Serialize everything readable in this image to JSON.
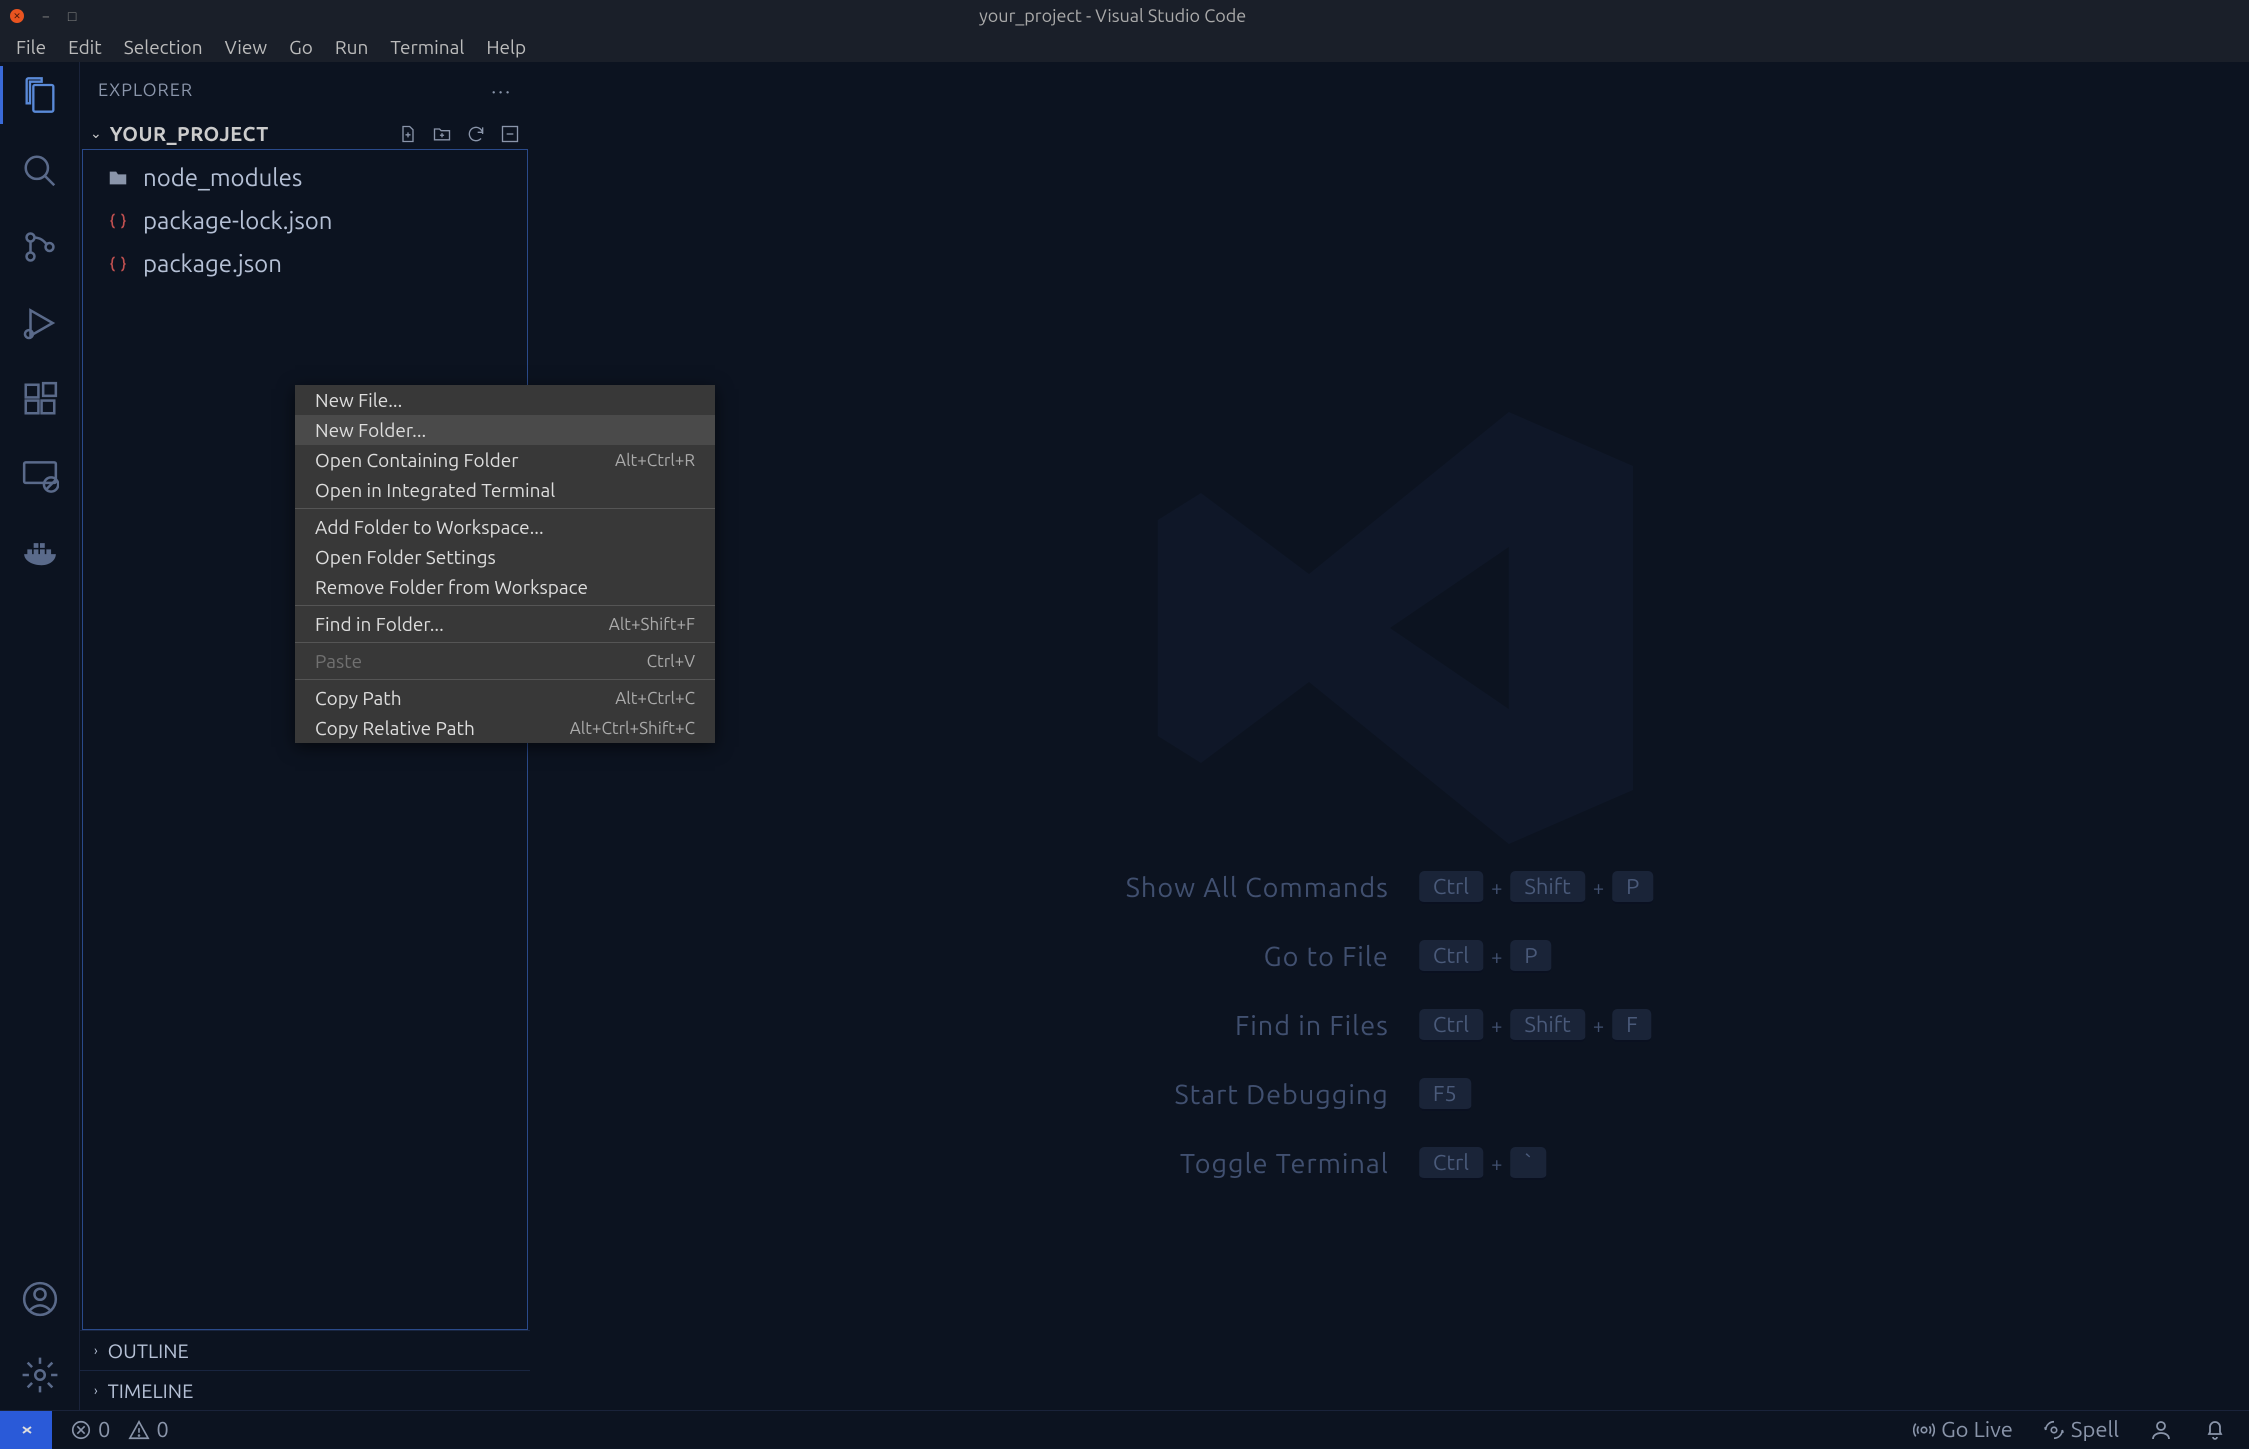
{
  "titlebar": {
    "title": "your_project - Visual Studio Code"
  },
  "menubar": [
    "File",
    "Edit",
    "Selection",
    "View",
    "Go",
    "Run",
    "Terminal",
    "Help"
  ],
  "sidebar": {
    "title": "EXPLORER",
    "folder": "YOUR_PROJECT",
    "files": [
      {
        "name": "node_modules",
        "type": "folder"
      },
      {
        "name": "package-lock.json",
        "type": "json"
      },
      {
        "name": "package.json",
        "type": "json"
      }
    ]
  },
  "panels": {
    "outline": "OUTLINE",
    "timeline": "TIMELINE"
  },
  "context_menu": {
    "groups": [
      [
        {
          "label": "New File...",
          "shortcut": ""
        },
        {
          "label": "New Folder...",
          "shortcut": "",
          "hover": true
        },
        {
          "label": "Open Containing Folder",
          "shortcut": "Alt+Ctrl+R"
        },
        {
          "label": "Open in Integrated Terminal",
          "shortcut": ""
        }
      ],
      [
        {
          "label": "Add Folder to Workspace...",
          "shortcut": ""
        },
        {
          "label": "Open Folder Settings",
          "shortcut": ""
        },
        {
          "label": "Remove Folder from Workspace",
          "shortcut": ""
        }
      ],
      [
        {
          "label": "Find in Folder...",
          "shortcut": "Alt+Shift+F"
        }
      ],
      [
        {
          "label": "Paste",
          "shortcut": "Ctrl+V",
          "disabled": true
        }
      ],
      [
        {
          "label": "Copy Path",
          "shortcut": "Alt+Ctrl+C"
        },
        {
          "label": "Copy Relative Path",
          "shortcut": "Alt+Ctrl+Shift+C"
        }
      ]
    ]
  },
  "shortcuts": [
    {
      "label": "Show All Commands",
      "keys": [
        "Ctrl",
        "Shift",
        "P"
      ]
    },
    {
      "label": "Go to File",
      "keys": [
        "Ctrl",
        "P"
      ]
    },
    {
      "label": "Find in Files",
      "keys": [
        "Ctrl",
        "Shift",
        "F"
      ]
    },
    {
      "label": "Start Debugging",
      "keys": [
        "F5"
      ]
    },
    {
      "label": "Toggle Terminal",
      "keys": [
        "Ctrl",
        "`"
      ]
    }
  ],
  "statusbar": {
    "errors": "0",
    "warnings": "0",
    "golive": "Go Live",
    "spell": "Spell"
  }
}
